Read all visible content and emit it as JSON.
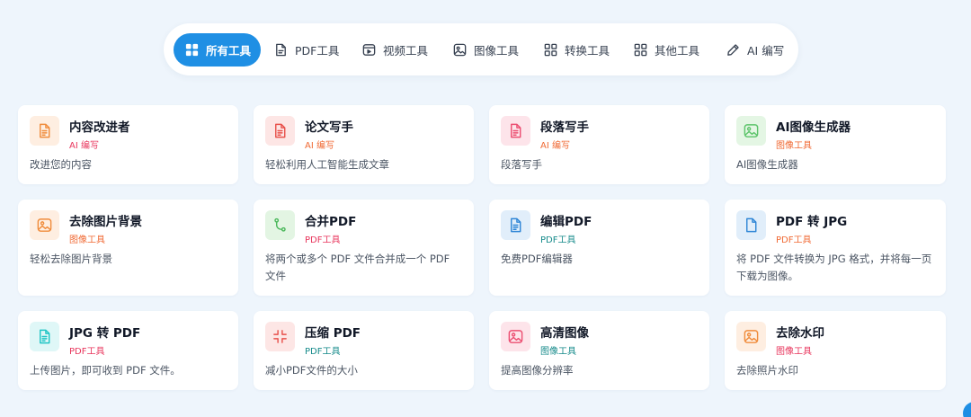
{
  "tabs": [
    {
      "label": "所有工具",
      "icon": "grid-icon",
      "active": true
    },
    {
      "label": "PDF工具",
      "icon": "document-icon",
      "active": false
    },
    {
      "label": "视频工具",
      "icon": "video-icon",
      "active": false
    },
    {
      "label": "图像工具",
      "icon": "image-icon",
      "active": false
    },
    {
      "label": "转换工具",
      "icon": "squares-icon",
      "active": false
    },
    {
      "label": "其他工具",
      "icon": "squares-icon",
      "active": false
    },
    {
      "label": "AI 编写",
      "icon": "pencil-icon",
      "active": false
    }
  ],
  "cards": [
    {
      "title": "内容改进者",
      "category": "AI 编写",
      "description": "改进您的内容",
      "icon": "document-icon",
      "icon_color": "#f08c3c",
      "icon_bg": "#feeee1",
      "category_color": "#e8365d"
    },
    {
      "title": "论文写手",
      "category": "AI 编写",
      "description": "轻松利用人工智能生成文章",
      "icon": "document-icon",
      "icon_color": "#e8504a",
      "icon_bg": "#fde6e5",
      "category_color": "#f06a34"
    },
    {
      "title": "段落写手",
      "category": "AI 编写",
      "description": "段落写手",
      "icon": "document-icon",
      "icon_color": "#ec4f72",
      "icon_bg": "#fde4ea",
      "category_color": "#f06a34"
    },
    {
      "title": "AI图像生成器",
      "category": "图像工具",
      "description": "AI图像生成器",
      "icon": "image-icon",
      "icon_color": "#5cc46a",
      "icon_bg": "#e4f6e4",
      "category_color": "#f06a34"
    },
    {
      "title": "去除图片背景",
      "category": "图像工具",
      "description": "轻松去除图片背景",
      "icon": "image-icon",
      "icon_color": "#f08c3c",
      "icon_bg": "#feeee1",
      "category_color": "#f06a34"
    },
    {
      "title": "合并PDF",
      "category": "PDF工具",
      "description": "将两个或多个 PDF 文件合并成一个 PDF 文件",
      "icon": "merge-icon",
      "icon_color": "#4cb85c",
      "icon_bg": "#e3f5e3",
      "category_color": "#e8365d"
    },
    {
      "title": "编辑PDF",
      "category": "PDF工具",
      "description": "免费PDF编辑器",
      "icon": "document-icon",
      "icon_color": "#2f86d6",
      "icon_bg": "#e1eefa",
      "category_color": "#178b8b"
    },
    {
      "title": "PDF 转 JPG",
      "category": "PDF工具",
      "description": "将 PDF 文件转换为 JPG 格式，并将每一页下载为图像。",
      "icon": "file-icon",
      "icon_color": "#2f86d6",
      "icon_bg": "#e1eefa",
      "category_color": "#f06a34"
    },
    {
      "title": "JPG 转 PDF",
      "category": "PDF工具",
      "description": "上传图片，即可收到 PDF 文件。",
      "icon": "document-icon",
      "icon_color": "#20c5c5",
      "icon_bg": "#dff7f7",
      "category_color": "#e8365d"
    },
    {
      "title": "压缩 PDF",
      "category": "PDF工具",
      "description": "减小PDF文件的大小",
      "icon": "compress-icon",
      "icon_color": "#e8504a",
      "icon_bg": "#fde6e5",
      "category_color": "#178b8b"
    },
    {
      "title": "高清图像",
      "category": "图像工具",
      "description": "提高图像分辨率",
      "icon": "image-icon",
      "icon_color": "#ec4f72",
      "icon_bg": "#fde4ea",
      "category_color": "#178b8b"
    },
    {
      "title": "去除水印",
      "category": "图像工具",
      "description": "去除照片水印",
      "icon": "image-icon",
      "icon_color": "#f08c3c",
      "icon_bg": "#feeee1",
      "category_color": "#e8365d"
    }
  ],
  "colors": {
    "accent": "#1f8fe4",
    "background": "#eef5fc"
  }
}
